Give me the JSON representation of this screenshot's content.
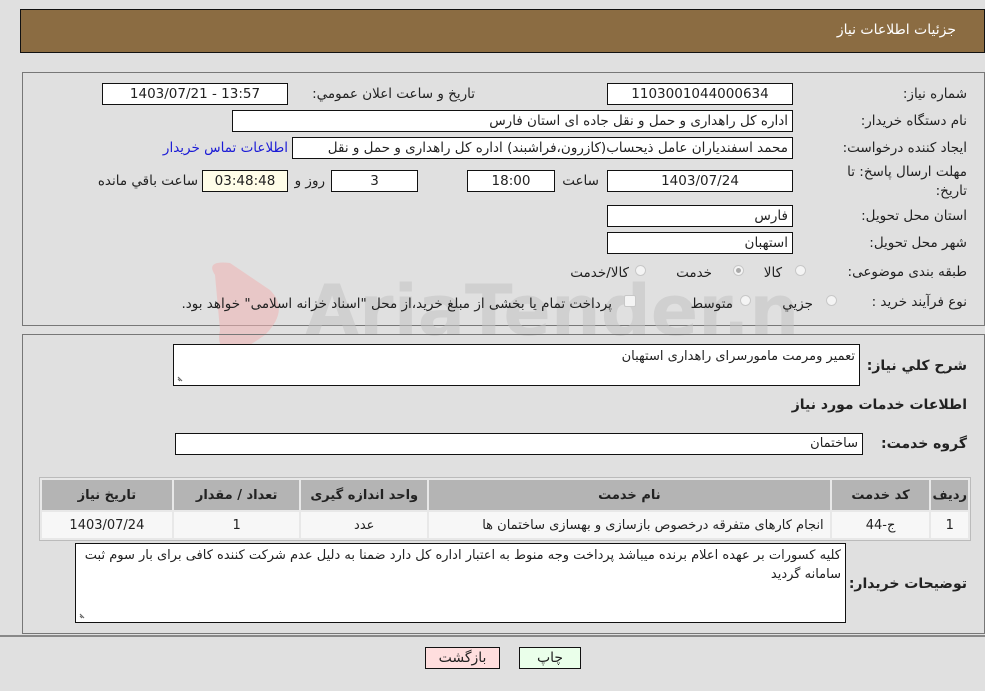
{
  "header": {
    "title": "جزئيات اطلاعات نیاز"
  },
  "details": {
    "need_number_label": "شماره نیاز:",
    "need_number": "1103001044000634",
    "announce_label": "تاریخ و ساعت اعلان عمومي:",
    "announce_value": "1403/07/21 - 13:57",
    "buyer_org_label": "نام دستگاه خریدار:",
    "buyer_org": "اداره کل راهداری و حمل و نقل جاده ای استان فارس",
    "creator_label": "ایجاد کننده درخواست:",
    "creator": "محمد اسفندیاران عامل ذیحساب(کازرون،فراشبند) اداره کل راهداری و حمل و نقل",
    "contact_link": "اطلاعات تماس خریدار",
    "deadline_label_line1": "مهلت ارسال پاسخ: تا",
    "deadline_label_line2": "تاریخ:",
    "deadline_date": "1403/07/24",
    "time_label": "ساعت",
    "deadline_time": "18:00",
    "days_value": "3",
    "days_label": "روز و",
    "remaining_time": "03:48:48",
    "remaining_label": "ساعت باقي مانده",
    "province_label": "استان محل تحویل:",
    "province": "فارس",
    "city_label": "شهر محل تحویل:",
    "city": "استهبان",
    "category_label": "طبقه بندی موضوعی:",
    "category_options": [
      {
        "label": "کالا",
        "selected": false
      },
      {
        "label": "خدمت",
        "selected": true
      },
      {
        "label": "کالا/خدمت",
        "selected": false
      }
    ],
    "purchase_type_label": "نوع فرآیند خرید :",
    "purchase_options": [
      {
        "label": "جزيي",
        "selected": false
      },
      {
        "label": "متوسط",
        "selected": false
      }
    ],
    "treasury_note": "پرداخت تمام یا بخشی از مبلغ خرید،از محل \"اسناد خزانه اسلامی\" خواهد بود."
  },
  "description": {
    "label": "شرح کلي نیاز:",
    "value": "تعمیر ومرمت مامورسرای راهداری استهبان"
  },
  "services": {
    "section_title": "اطلاعات خدمات مورد نیاز",
    "group_label": "گروه خدمت:",
    "group_value": "ساختمان",
    "table": {
      "headers": [
        "ردیف",
        "کد خدمت",
        "نام خدمت",
        "واحد اندازه گیری",
        "تعداد / مقدار",
        "تاریخ نیاز"
      ],
      "rows": [
        [
          "1",
          "ج-44",
          "انجام کارهای متفرقه درخصوص بازسازی و بهسازی ساختمان ها",
          "عدد",
          "1",
          "1403/07/24"
        ]
      ]
    }
  },
  "buyer_notes": {
    "label": "توضیحات خریدار:",
    "value": "کلیه کسورات بر عهده اعلام برنده میباشد پرداخت وجه منوط به اعتبار اداره کل دارد ضمنا به دلیل عدم شرکت کننده کافی برای بار سوم ثبت سامانه گردید"
  },
  "buttons": {
    "print": "چاپ",
    "back": "بازگشت"
  },
  "colors": {
    "header_bg": "#8b6c42",
    "link": "#1b1bd6",
    "print_bg": "#eaffea",
    "back_bg": "#ffdede"
  },
  "watermark": {
    "text": "AriaTender.neT"
  }
}
